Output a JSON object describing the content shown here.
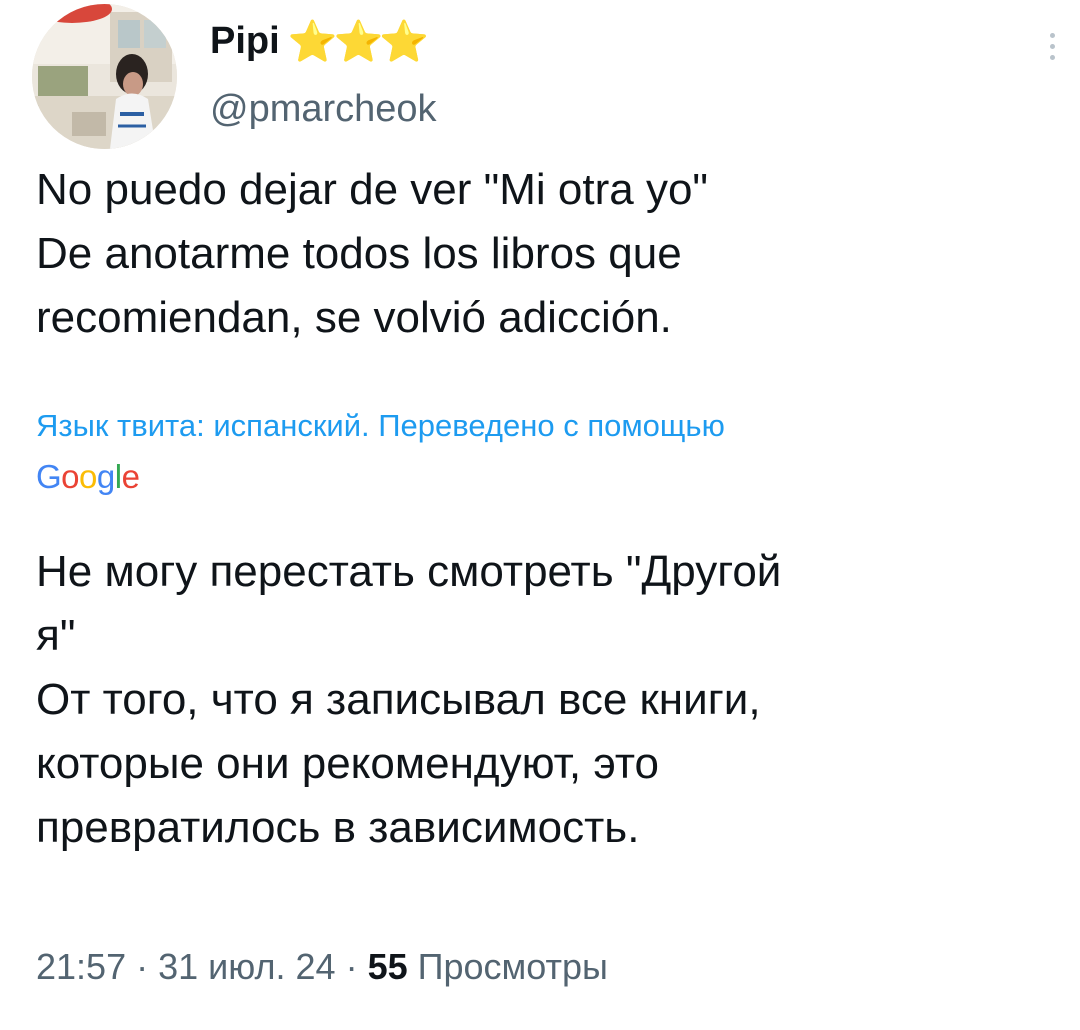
{
  "author": {
    "display_name": "Pipi",
    "badge": "⭐⭐⭐",
    "handle": "@pmarcheok"
  },
  "tweet": {
    "original_lines": [
      "No puedo dejar de ver \"Mi otra yo\"",
      "De anotarme todos los libros que",
      "recomiendan, se volvió adicción."
    ],
    "translation_note": "Язык твита: испанский. Переведено с помощью",
    "translation_provider": "Google",
    "translated_lines": [
      "Не могу перестать смотреть \"Другой",
      "я\"",
      "От того, что я записывал все книги,",
      "которые они рекомендуют, это",
      "превратилось в зависимость."
    ]
  },
  "meta": {
    "time": "21:57",
    "separator": "·",
    "date": "31 июл. 24",
    "views_count": "55",
    "views_label": "Просмотры"
  },
  "icons": {
    "more": "more-vertical-icon",
    "stars": "star-icon"
  },
  "colors": {
    "link_blue": "#1d9bf0",
    "secondary_text": "#536471",
    "primary_text": "#0f1419",
    "star_gold": "#f6c12b"
  }
}
